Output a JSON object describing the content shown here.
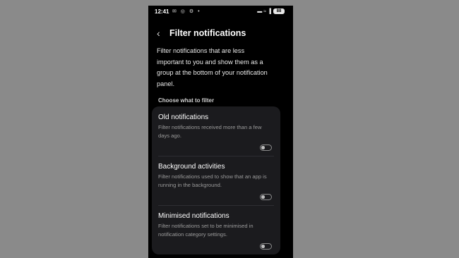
{
  "status_bar": {
    "time": "12:41",
    "left_icons": "✉ ◎ ⚙ •",
    "right_icons": "▬ ≈ ▐",
    "battery": "88"
  },
  "header": {
    "title": "Filter notifications"
  },
  "description": "Filter notifications that are less important to you and show them as a group at the bottom of your notification panel.",
  "section_label": "Choose what to filter",
  "options": [
    {
      "title": "Old notifications",
      "description": "Filter notifications received more than a few days ago.",
      "enabled": false
    },
    {
      "title": "Background activities",
      "description": "Filter notifications used to show that an app is running in the background.",
      "enabled": false
    },
    {
      "title": "Minimised notifications",
      "description": "Filter notifications set to be minimised in notification category settings.",
      "enabled": false
    }
  ]
}
